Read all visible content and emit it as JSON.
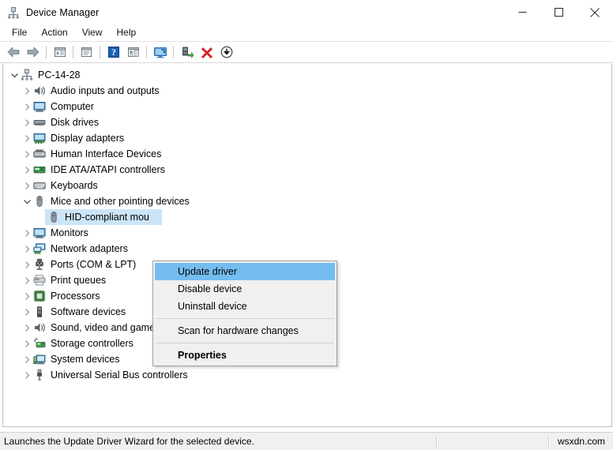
{
  "window": {
    "title": "Device Manager",
    "icon": "device-manager-icon",
    "controls": {
      "minimize": "minimize-icon",
      "maximize": "maximize-icon",
      "close": "close-icon"
    }
  },
  "menubar": {
    "items": [
      {
        "label": "File"
      },
      {
        "label": "Action"
      },
      {
        "label": "View"
      },
      {
        "label": "Help"
      }
    ]
  },
  "toolbar": {
    "buttons": [
      {
        "name": "back-button",
        "icon": "back-arrow-icon"
      },
      {
        "name": "forward-button",
        "icon": "forward-arrow-icon"
      },
      {
        "name": "separator-1",
        "icon": "separator"
      },
      {
        "name": "show-hide-console-tree-button",
        "icon": "console-tree-icon"
      },
      {
        "name": "separator-2",
        "icon": "separator"
      },
      {
        "name": "properties-button",
        "icon": "properties-window-icon"
      },
      {
        "name": "separator-3",
        "icon": "separator"
      },
      {
        "name": "help-button",
        "icon": "help-question-icon"
      },
      {
        "name": "show-hide-action-pane-button",
        "icon": "action-pane-icon"
      },
      {
        "name": "separator-4",
        "icon": "separator"
      },
      {
        "name": "scan-for-hardware-changes-button",
        "icon": "scan-monitor-icon"
      },
      {
        "name": "separator-5",
        "icon": "separator"
      },
      {
        "name": "update-driver-button",
        "icon": "update-driver-icon"
      },
      {
        "name": "uninstall-device-button",
        "icon": "red-x-icon"
      },
      {
        "name": "disable-device-button",
        "icon": "disable-arrow-down-icon"
      }
    ]
  },
  "tree": {
    "root": {
      "label": "PC-14-28",
      "icon": "computer-root-icon",
      "expanded": true,
      "chevron": "chevron-down-icon"
    },
    "nodes": [
      {
        "label": "Audio inputs and outputs",
        "icon": "speaker-icon",
        "expanded": false,
        "chevron": "chevron-right-icon"
      },
      {
        "label": "Computer",
        "icon": "monitor-icon",
        "expanded": false,
        "chevron": "chevron-right-icon"
      },
      {
        "label": "Disk drives",
        "icon": "disk-drive-icon",
        "expanded": false,
        "chevron": "chevron-right-icon"
      },
      {
        "label": "Display adapters",
        "icon": "display-adapter-icon",
        "expanded": false,
        "chevron": "chevron-right-icon"
      },
      {
        "label": "Human Interface Devices",
        "icon": "hid-icon",
        "expanded": false,
        "chevron": "chevron-right-icon"
      },
      {
        "label": "IDE ATA/ATAPI controllers",
        "icon": "ide-controller-icon",
        "expanded": false,
        "chevron": "chevron-right-icon"
      },
      {
        "label": "Keyboards",
        "icon": "keyboard-icon",
        "expanded": false,
        "chevron": "chevron-right-icon"
      },
      {
        "label": "Mice and other pointing devices",
        "icon": "mouse-icon",
        "expanded": true,
        "chevron": "chevron-down-icon",
        "children": [
          {
            "label": "HID-compliant mou",
            "icon": "mouse-icon",
            "selected": true
          }
        ]
      },
      {
        "label": "Monitors",
        "icon": "monitor-icon",
        "expanded": false,
        "chevron": "chevron-right-icon"
      },
      {
        "label": "Network adapters",
        "icon": "network-adapter-icon",
        "expanded": false,
        "chevron": "chevron-right-icon"
      },
      {
        "label": "Ports (COM & LPT)",
        "icon": "port-icon",
        "expanded": false,
        "chevron": "chevron-right-icon"
      },
      {
        "label": "Print queues",
        "icon": "printer-icon",
        "expanded": false,
        "chevron": "chevron-right-icon"
      },
      {
        "label": "Processors",
        "icon": "processor-icon",
        "expanded": false,
        "chevron": "chevron-right-icon"
      },
      {
        "label": "Software devices",
        "icon": "software-device-icon",
        "expanded": false,
        "chevron": "chevron-right-icon"
      },
      {
        "label": "Sound, video and game controllers",
        "icon": "speaker-icon",
        "expanded": false,
        "chevron": "chevron-right-icon"
      },
      {
        "label": "Storage controllers",
        "icon": "storage-controller-icon",
        "expanded": false,
        "chevron": "chevron-right-icon"
      },
      {
        "label": "System devices",
        "icon": "system-device-icon",
        "expanded": false,
        "chevron": "chevron-right-icon"
      },
      {
        "label": "Universal Serial Bus controllers",
        "icon": "usb-icon",
        "expanded": false,
        "chevron": "chevron-right-icon"
      }
    ]
  },
  "context_menu": {
    "items": [
      {
        "label": "Update driver",
        "highlighted": true,
        "bold": false
      },
      {
        "label": "Disable device",
        "highlighted": false,
        "bold": false
      },
      {
        "label": "Uninstall device",
        "highlighted": false,
        "bold": false
      },
      {
        "separator": true
      },
      {
        "label": "Scan for hardware changes",
        "highlighted": false,
        "bold": false
      },
      {
        "separator": true
      },
      {
        "label": "Properties",
        "highlighted": false,
        "bold": true
      }
    ]
  },
  "statusbar": {
    "message": "Launches the Update Driver Wizard for the selected device.",
    "watermark": "wsxdn.com"
  },
  "colors": {
    "selection_blue": "#cce4f7",
    "menu_highlight_blue": "#75bdf0",
    "menu_background": "#f1f0ef",
    "status_background": "#f0f0f0",
    "accent_red": "#d42121",
    "accent_green": "#3f9a3f"
  }
}
